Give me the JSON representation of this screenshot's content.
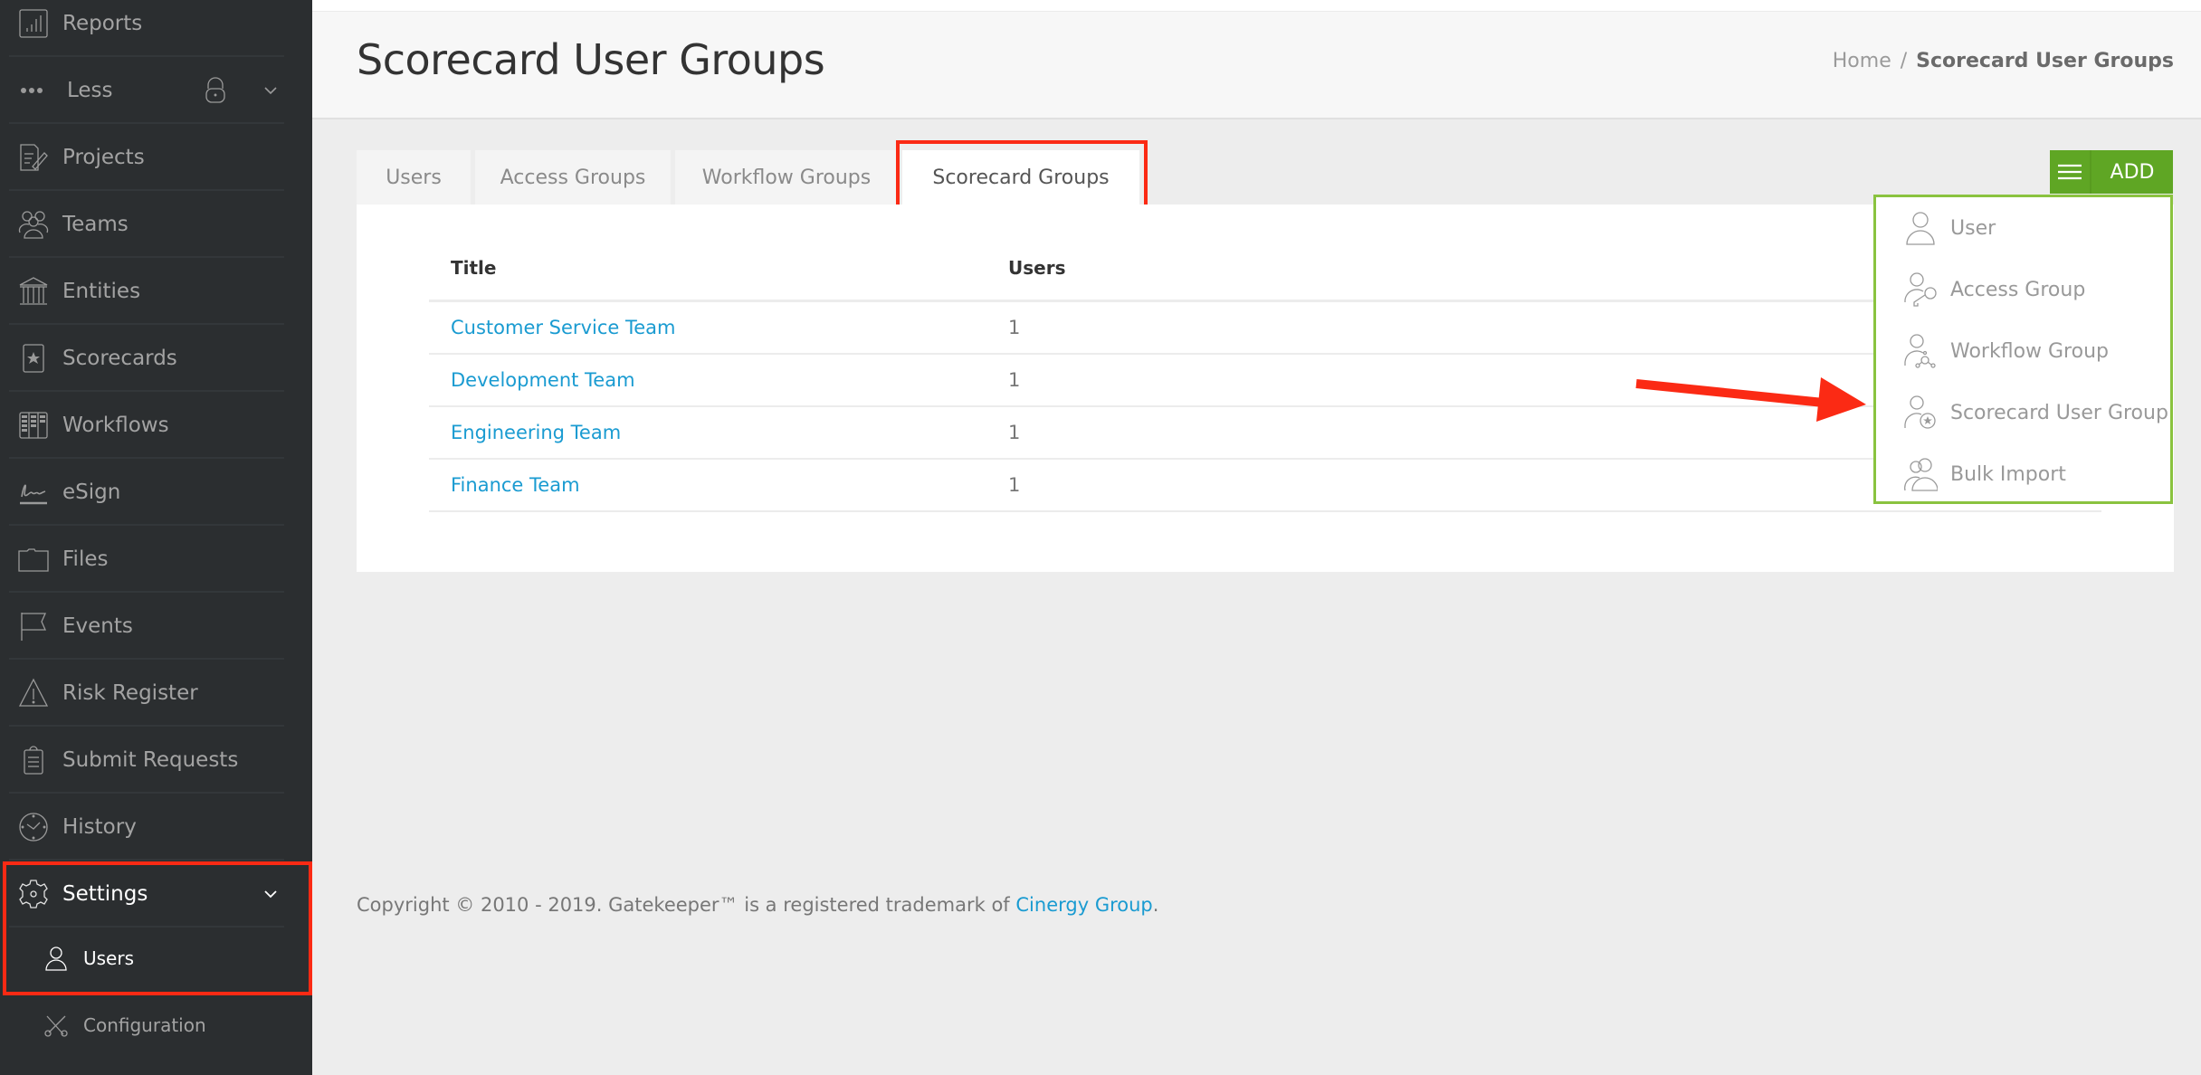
{
  "sidebar": {
    "items": [
      {
        "label": "Reports",
        "icon": "bar-chart-icon"
      },
      {
        "label": "Less",
        "icon": "more-dots-icon"
      },
      {
        "label": "Projects",
        "icon": "document-pen-icon"
      },
      {
        "label": "Teams",
        "icon": "team-icon"
      },
      {
        "label": "Entities",
        "icon": "building-icon"
      },
      {
        "label": "Scorecards",
        "icon": "star-card-icon"
      },
      {
        "label": "Workflows",
        "icon": "kanban-icon"
      },
      {
        "label": "eSign",
        "icon": "signature-icon"
      },
      {
        "label": "Files",
        "icon": "folder-icon"
      },
      {
        "label": "Events",
        "icon": "flag-icon"
      },
      {
        "label": "Risk Register",
        "icon": "warning-icon"
      },
      {
        "label": "Submit Requests",
        "icon": "clipboard-icon"
      },
      {
        "label": "History",
        "icon": "clock-icon"
      },
      {
        "label": "Settings",
        "icon": "gear-icon"
      }
    ],
    "sub_items": [
      {
        "label": "Users",
        "icon": "user-icon"
      },
      {
        "label": "Configuration",
        "icon": "tools-icon"
      }
    ]
  },
  "header": {
    "title": "Scorecard User Groups",
    "breadcrumb": {
      "home": "Home",
      "separator": "/",
      "current": "Scorecard User Groups"
    }
  },
  "tabs": [
    {
      "label": "Users",
      "active": false
    },
    {
      "label": "Access Groups",
      "active": false
    },
    {
      "label": "Workflow Groups",
      "active": false
    },
    {
      "label": "Scorecard Groups",
      "active": true
    }
  ],
  "table": {
    "columns": [
      "Title",
      "Users"
    ],
    "rows": [
      {
        "title": "Customer Service Team",
        "users": "1"
      },
      {
        "title": "Development Team",
        "users": "1"
      },
      {
        "title": "Engineering Team",
        "users": "1"
      },
      {
        "title": "Finance Team",
        "users": "1"
      }
    ]
  },
  "add_button": {
    "label": "ADD",
    "color": "#5fa624"
  },
  "add_menu": {
    "items": [
      {
        "label": "User",
        "icon": "user-icon"
      },
      {
        "label": "Access Group",
        "icon": "user-key-icon"
      },
      {
        "label": "Workflow Group",
        "icon": "user-workflow-icon"
      },
      {
        "label": "Scorecard User Group",
        "icon": "user-star-icon"
      },
      {
        "label": "Bulk Import",
        "icon": "users-icon"
      }
    ],
    "border_color": "#8ac33f"
  },
  "footer": {
    "text": "Copyright © 2010 - 2019. Gatekeeper™ is a registered trademark of ",
    "link": "Cinergy Group",
    "end": "."
  },
  "annotations": {
    "highlight_color": "#fb2a14"
  }
}
